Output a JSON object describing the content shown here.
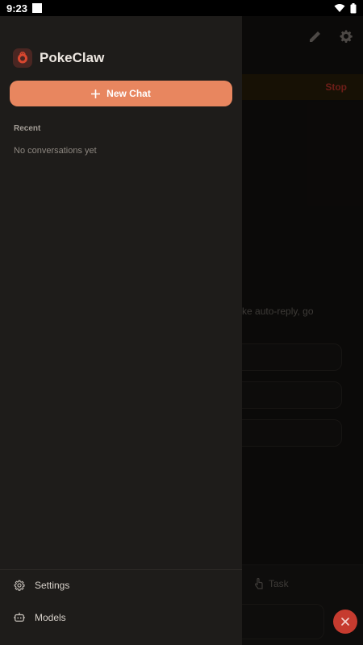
{
  "status_bar": {
    "time": "9:23"
  },
  "app": {
    "name": "PokeClaw",
    "new_chat_label": "New Chat",
    "recent_heading": "Recent",
    "empty_state": "No conversations yet"
  },
  "drawer_menu": {
    "items": [
      {
        "label": "Settings",
        "icon": "gear-icon"
      },
      {
        "label": "Models",
        "icon": "robot-icon"
      }
    ]
  },
  "background": {
    "banner_action": "Stop",
    "hint_text": "and tasks like auto-reply, go",
    "mode_label": "Task"
  },
  "colors": {
    "accent": "#e8865f",
    "drawer_bg": "#1e1c1a",
    "danger": "#c63b2f"
  }
}
